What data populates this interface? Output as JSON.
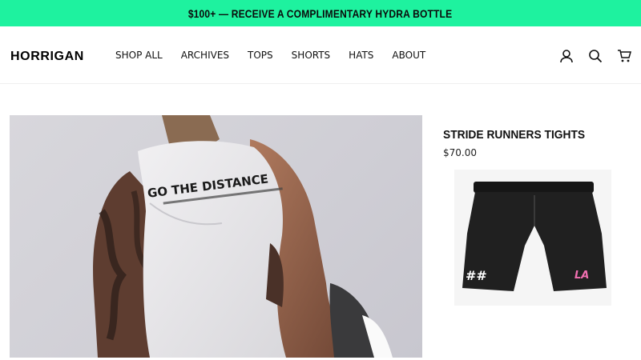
{
  "promo": {
    "text": "$100+ — RECEIVE A COMPLIMENTARY HYDRA BOTTLE"
  },
  "header": {
    "logo": "HORRIGAN",
    "nav": [
      "SHOP ALL",
      "ARCHIVES",
      "TOPS",
      "SHORTS",
      "HATS",
      "ABOUT"
    ],
    "icons": [
      "account-icon",
      "search-icon",
      "cart-icon"
    ]
  },
  "hero": {
    "shirt_print": "GO THE DISTANCE",
    "accent_color": "#1ef29f"
  },
  "product": {
    "title": "STRIDE RUNNERS TIGHTS",
    "price": "$70.00"
  }
}
